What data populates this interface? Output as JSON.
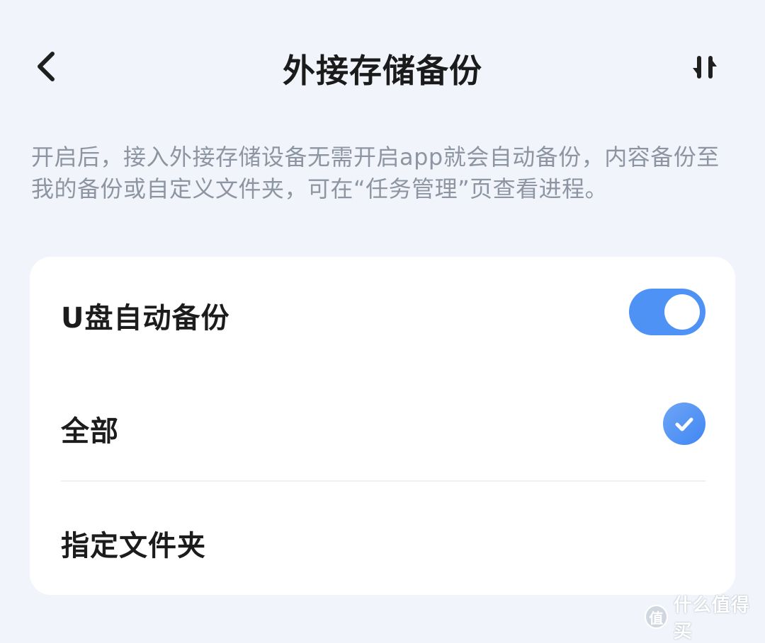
{
  "header": {
    "title": "外接存储备份",
    "back_icon": "chevron-left-icon",
    "sort_icon": "sort-arrows-icon"
  },
  "description": "开启后，接入外接存储设备无需开启app就会自动备份，内容备份至我的备份或自定义文件夹，可在“任务管理”页查看进程。",
  "settings": {
    "auto_backup": {
      "label": "U盘自动备份",
      "enabled": true
    },
    "options": [
      {
        "label": "全部",
        "selected": true
      },
      {
        "label": "指定文件夹",
        "selected": false
      }
    ]
  },
  "watermark": {
    "logo_text": "值",
    "text": "什么值得买"
  },
  "colors": {
    "background": "#f1f5fb",
    "accent": "#4e92f6",
    "description_text": "#8e95a2",
    "card": "#ffffff"
  }
}
